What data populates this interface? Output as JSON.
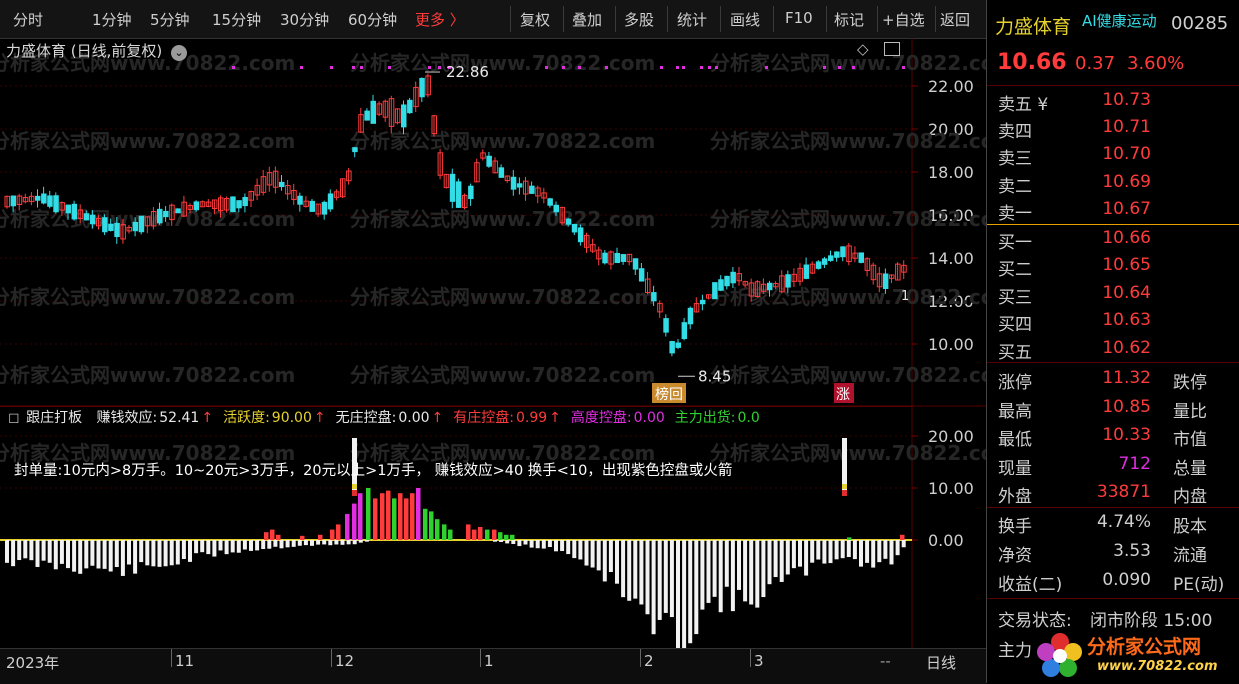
{
  "toolbar": {
    "periods": [
      "分时",
      "1分钟",
      "5分钟",
      "15分钟",
      "30分钟",
      "60分钟"
    ],
    "more": "更多 〉",
    "buttons": [
      "复权",
      "叠加",
      "多股",
      "统计",
      "画线",
      "F10",
      "标记",
      "+自选",
      "返回"
    ]
  },
  "chart": {
    "title": "力盛体育 (日线,前复权)",
    "y_ticks": [
      "22.00",
      "20.00",
      "18.00",
      "16.00",
      "14.00",
      "12.00",
      "10.00"
    ],
    "high_label": "22.86",
    "low_label": "8.45",
    "badge_left": "榜回",
    "badge_right": "涨",
    "edge_label": "1"
  },
  "indicator": {
    "name": "跟庄打板",
    "items": [
      {
        "label": "赚钱效应:",
        "value": "52.41",
        "arrow": "↑",
        "color": "#e8e8e8"
      },
      {
        "label": "活跃度:",
        "value": "90.00",
        "arrow": "↑",
        "color": "#e6d22e"
      },
      {
        "label": "无庄控盘:",
        "value": "0.00",
        "arrow": "↑",
        "color": "#e8e8e8"
      },
      {
        "label": "有庄控盘:",
        "value": "0.99",
        "arrow": "↑",
        "color": "#ff3b3b"
      },
      {
        "label": "高度控盘:",
        "value": "0.00",
        "arrow": "",
        "color": "#e02ee0"
      },
      {
        "label": "主力出货:",
        "value": "0.0",
        "arrow": "",
        "color": "#2fd12f"
      }
    ],
    "note": "封单量:10元内>8万手。10~20元>3万手，20元以上>1万手， 赚钱效应>40 换手<10，出现紫色控盘或火箭",
    "y_ticks": [
      "20.00",
      "10.00",
      "0.00"
    ]
  },
  "timeline": {
    "labels": [
      {
        "text": "2023年"
      },
      {
        "text": "11"
      },
      {
        "text": "12"
      },
      {
        "text": "1"
      },
      {
        "text": "2"
      },
      {
        "text": "3"
      }
    ],
    "dash": "--",
    "period": "日线"
  },
  "quote": {
    "name": "力盛体育",
    "tag": "AI健康运动",
    "code": "00285",
    "price": "10.66",
    "change": "0.37",
    "pct": "3.60%",
    "asks": [
      {
        "label": "卖五 ¥",
        "price": "10.73"
      },
      {
        "label": "卖四",
        "price": "10.71"
      },
      {
        "label": "卖三",
        "price": "10.70"
      },
      {
        "label": "卖二",
        "price": "10.69"
      },
      {
        "label": "卖一",
        "price": "10.67"
      }
    ],
    "bids": [
      {
        "label": "买一",
        "price": "10.66"
      },
      {
        "label": "买二",
        "price": "10.65"
      },
      {
        "label": "买三",
        "price": "10.64"
      },
      {
        "label": "买四",
        "price": "10.63"
      },
      {
        "label": "买五",
        "price": "10.62"
      }
    ],
    "stats1": [
      {
        "label": "涨停",
        "value": "11.32",
        "label2": "跌停",
        "color": "#ff3b3b"
      },
      {
        "label": "最高",
        "value": "10.85",
        "label2": "量比",
        "color": "#ff3b3b"
      },
      {
        "label": "最低",
        "value": "10.33",
        "label2": "市值",
        "color": "#ff3b3b"
      },
      {
        "label": "现量",
        "value": "712",
        "label2": "总量",
        "color": "#e02ee0"
      },
      {
        "label": "外盘",
        "value": "33871",
        "label2": "内盘",
        "color": "#ff3b3b"
      }
    ],
    "stats2": [
      {
        "label": "换手",
        "value": "4.74%",
        "label2": "股本"
      },
      {
        "label": "净资",
        "value": "3.53",
        "label2": "流通"
      },
      {
        "label": "收益(二)",
        "value": "0.090",
        "label2": "PE(动)"
      }
    ],
    "status_label": "交易状态:",
    "status_value": "闭市阶段 15:00",
    "bottom_partial": "主力",
    "logo_text": "分析家公式网",
    "logo_url": "www.70822.com",
    "watermark": "分析家公式网www.70822.com"
  },
  "colors": {
    "up": "#ff3b3b",
    "down": "#33dde6",
    "ma": "#ffffff"
  }
}
